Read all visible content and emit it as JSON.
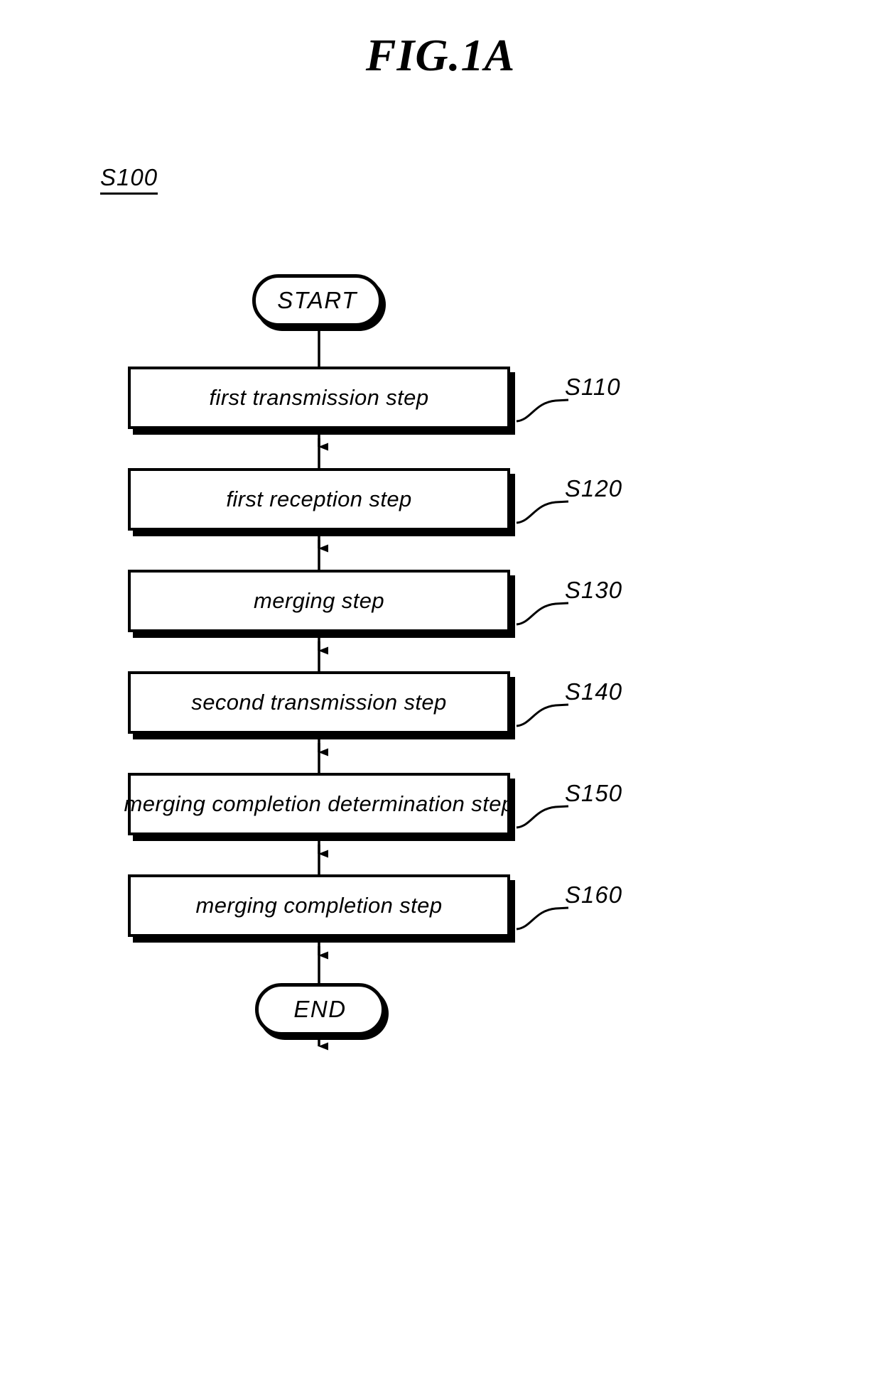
{
  "figure": {
    "title": "FIG.1A",
    "process_id": "S100"
  },
  "flowchart": {
    "type": "flowchart",
    "orientation": "vertical",
    "start_terminal": {
      "label": "START",
      "shape": "stadium"
    },
    "end_terminal": {
      "label": "END",
      "shape": "stadium"
    },
    "steps": [
      {
        "ref": "S110",
        "label": "first transmission step"
      },
      {
        "ref": "S120",
        "label": "first reception step"
      },
      {
        "ref": "S130",
        "label": "merging step"
      },
      {
        "ref": "S140",
        "label": "second transmission step"
      },
      {
        "ref": "S150",
        "label": "merging completion determination step"
      },
      {
        "ref": "S160",
        "label": "merging completion step"
      }
    ],
    "colors": {
      "stroke": "#000000",
      "fill": "#ffffff",
      "background": "#ffffff"
    }
  }
}
